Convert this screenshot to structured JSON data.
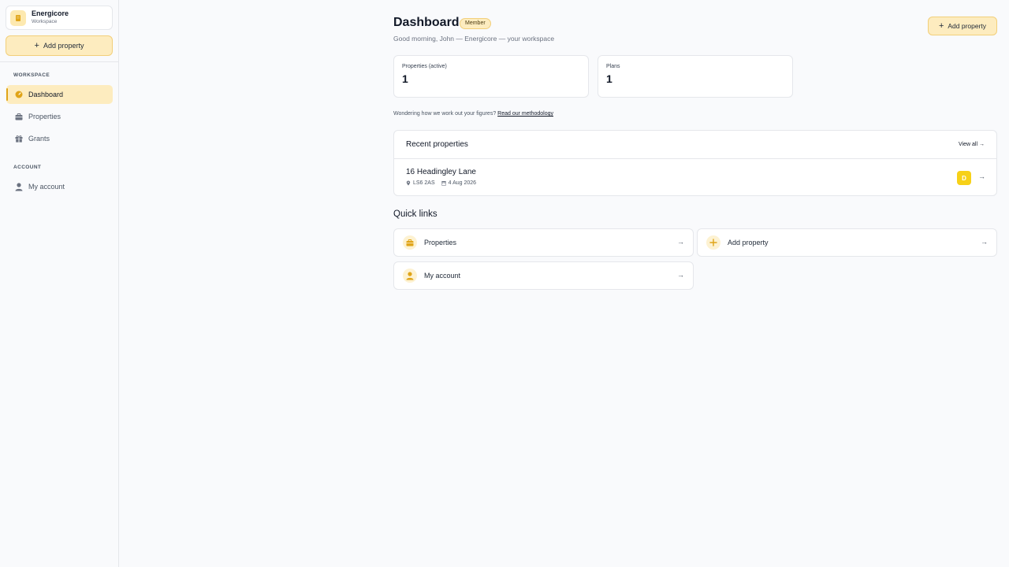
{
  "workspace": {
    "name": "Energicore",
    "subtitle": "Workspace"
  },
  "sidebar": {
    "add_label": "Add property",
    "sections": [
      {
        "title": "WORKSPACE"
      },
      {
        "title": "ACCOUNT"
      }
    ],
    "items": [
      {
        "label": "Dashboard",
        "icon": "dashboard-icon",
        "active": true
      },
      {
        "label": "Properties",
        "icon": "briefcase-icon"
      },
      {
        "label": "Grants",
        "icon": "gift-icon"
      },
      {
        "label": "My account",
        "icon": "user-icon"
      }
    ]
  },
  "header": {
    "title": "Dashboard",
    "badge": "Member",
    "greeting": "Good morning, John — Energicore — your workspace",
    "add_label": "Add property"
  },
  "stats": [
    {
      "label": "Properties (active)",
      "value": "1"
    },
    {
      "label": "Plans",
      "value": "1"
    }
  ],
  "methodology": {
    "text": "Wondering how we work out your figures?",
    "link": "Read our methodology"
  },
  "recent": {
    "title": "Recent properties",
    "view_all": "View all →",
    "items": [
      {
        "name": "16 Headingley Lane",
        "postcode": "LS6 2AS",
        "date": "4 Aug 2026",
        "rating": "D"
      }
    ]
  },
  "quick_links": {
    "title": "Quick links",
    "items": [
      {
        "label": "Properties",
        "icon": "briefcase-icon"
      },
      {
        "label": "Add property",
        "icon": "plus-icon"
      },
      {
        "label": "My account",
        "icon": "user-icon"
      }
    ]
  },
  "colors": {
    "accent": "#e0a417",
    "accent_bg": "#fdecbf",
    "rating_d": "#f7d118"
  }
}
